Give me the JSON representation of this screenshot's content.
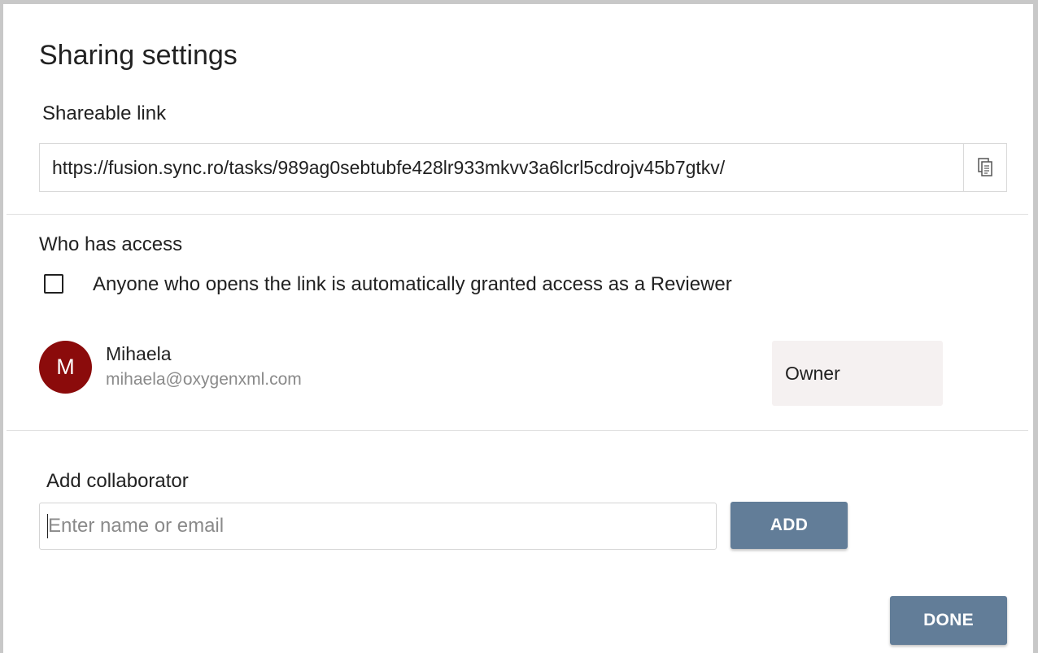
{
  "dialog": {
    "title": "Sharing settings"
  },
  "share_link": {
    "label": "Shareable link",
    "url": "https://fusion.sync.ro/tasks/989ag0sebtubfe428lr933mkvv3a6lcrl5cdrojv45b7gtkv/",
    "copy_icon": "copy-icon"
  },
  "access": {
    "label": "Who has access",
    "auto_grant_checked": false,
    "auto_grant_label": "Anyone who opens the link is automatically granted access as a Reviewer",
    "users": [
      {
        "initial": "M",
        "name": "Mihaela",
        "email": "mihaela@oxygenxml.com",
        "role": "Owner",
        "avatar_color": "#8b0b0b"
      }
    ]
  },
  "collaborator": {
    "label": "Add collaborator",
    "placeholder": "Enter name or email",
    "value": "",
    "add_label": "ADD"
  },
  "footer": {
    "done_label": "DONE"
  },
  "colors": {
    "button": "#627d98",
    "role_bg": "#f5f1f1",
    "frame_border": "#c8c8c8"
  }
}
